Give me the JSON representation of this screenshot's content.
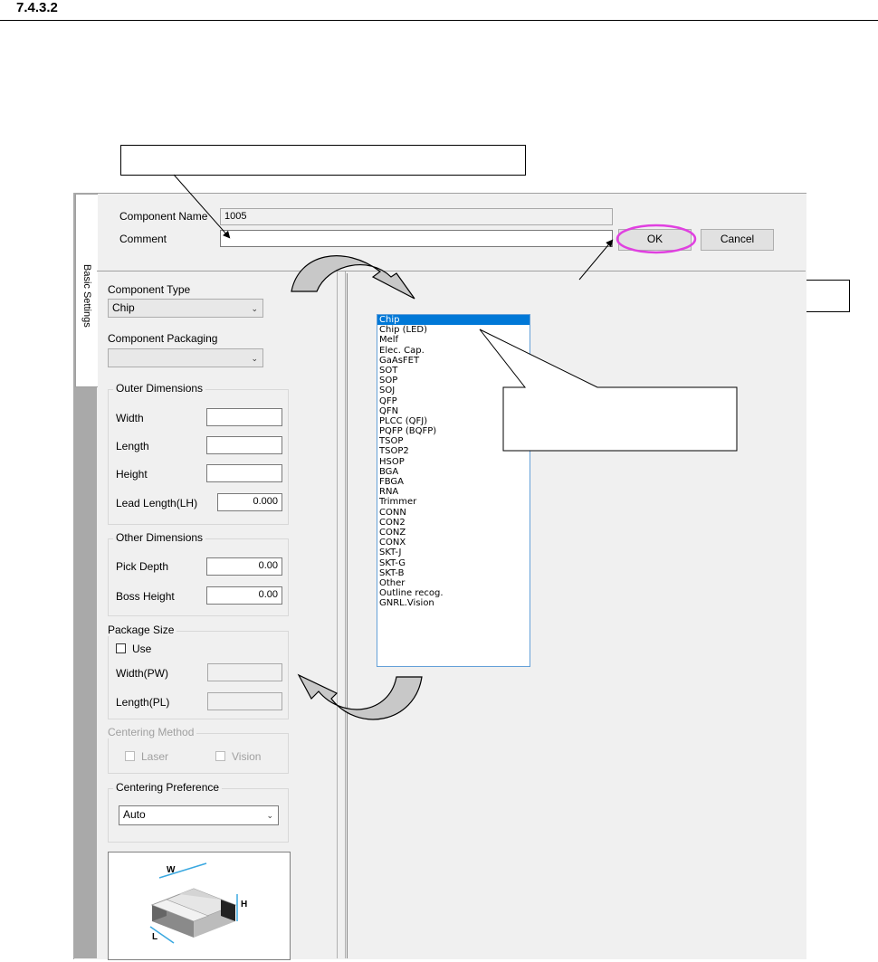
{
  "doc": {
    "section_number": "7.4.3.2"
  },
  "window": {
    "tab_label": "Basic Settings",
    "component_name_label": "Component Name",
    "component_name_value": "1005",
    "comment_label": "Comment",
    "comment_value": "",
    "ok_label": "OK",
    "cancel_label": "Cancel"
  },
  "left_panel": {
    "component_type_label": "Component Type",
    "component_type_value": "Chip",
    "component_packaging_label": "Component Packaging",
    "component_packaging_value": "",
    "outer_dimensions": {
      "title": "Outer Dimensions",
      "width_label": "Width",
      "width_value": "",
      "length_label": "Length",
      "length_value": "",
      "height_label": "Height",
      "height_value": "",
      "lead_length_label": "Lead Length(LH)",
      "lead_length_value": "0.000"
    },
    "other_dimensions": {
      "title": "Other Dimensions",
      "pick_depth_label": "Pick Depth",
      "pick_depth_value": "0.00",
      "boss_height_label": "Boss Height",
      "boss_height_value": "0.00"
    },
    "package_size": {
      "title": "Package Size",
      "use_label": "Use",
      "width_label": "Width(PW)",
      "width_value": "",
      "length_label": "Length(PL)",
      "length_value": ""
    },
    "centering_method": {
      "title": "Centering Method",
      "laser_label": "Laser",
      "vision_label": "Vision"
    },
    "centering_preference": {
      "title": "Centering Preference",
      "value": "Auto"
    },
    "diagram_labels": {
      "w": "W",
      "h": "H",
      "l": "L"
    }
  },
  "dropdown": {
    "items": [
      "Chip",
      "Chip (LED)",
      "Melf",
      "Elec. Cap.",
      "GaAsFET",
      "SOT",
      "SOP",
      "SOJ",
      "QFP",
      "QFN",
      "PLCC (QFJ)",
      "PQFP (BQFP)",
      "TSOP",
      "TSOP2",
      "HSOP",
      "BGA",
      "FBGA",
      "RNA",
      "Trimmer",
      "CONN",
      "CON2",
      "CONZ",
      "CONX",
      "SKT-J",
      "SKT-G",
      "SKT-B",
      "Other",
      "Outline recog.",
      "GNRL.Vision"
    ],
    "selected": "Chip"
  },
  "colors": {
    "selection": "#0078d7",
    "highlight_ring": "#e040e0",
    "arrow_fill": "#c8c8c8"
  }
}
